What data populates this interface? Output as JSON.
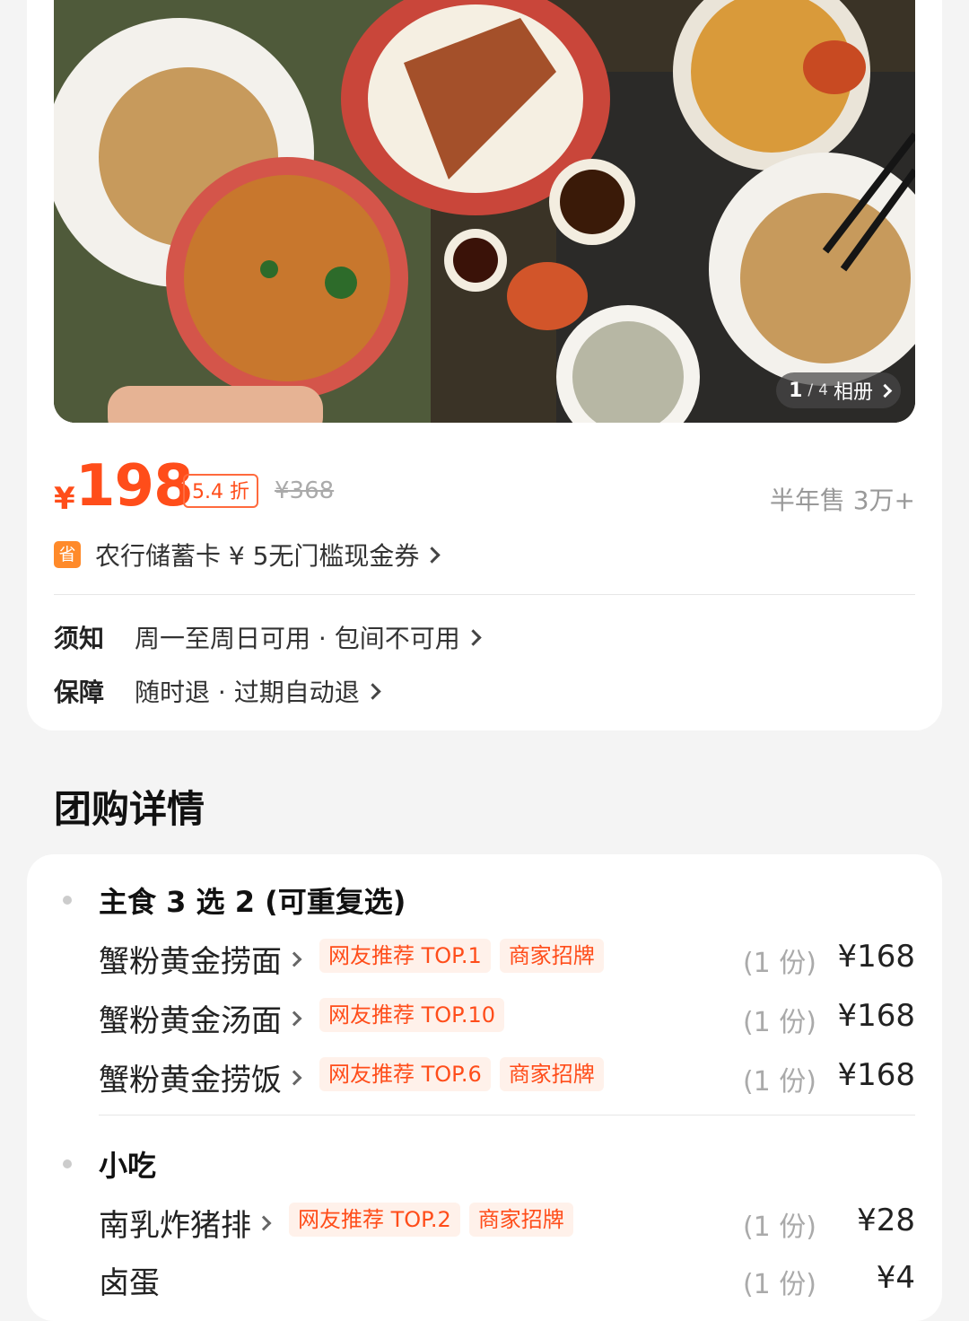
{
  "gallery": {
    "index": "1",
    "total": "4",
    "album_label": "相册"
  },
  "price": {
    "currency": "¥",
    "amount": "198",
    "discount": "5.4 折",
    "original": "¥368",
    "sales": "半年售 3万+"
  },
  "coupon": {
    "icon_text": "省",
    "text": "农行储蓄卡 ¥ 5无门槛现金券"
  },
  "notice": {
    "label": "须知",
    "value": "周一至周日可用 · 包间不可用"
  },
  "guarantee": {
    "label": "保障",
    "value": "随时退 · 过期自动退"
  },
  "section_title": "团购详情",
  "groups": [
    {
      "title": "主食 3 选 2 (可重复选)",
      "items": [
        {
          "name": "蟹粉黄金捞面",
          "tags": [
            "网友推荐 TOP.1",
            "商家招牌"
          ],
          "qty": "(1 份)",
          "price": "¥168"
        },
        {
          "name": "蟹粉黄金汤面",
          "tags": [
            "网友推荐 TOP.10"
          ],
          "qty": "(1 份)",
          "price": "¥168"
        },
        {
          "name": "蟹粉黄金捞饭",
          "tags": [
            "网友推荐 TOP.6",
            "商家招牌"
          ],
          "qty": "(1 份)",
          "price": "¥168"
        }
      ]
    },
    {
      "title": "小吃",
      "items": [
        {
          "name": "南乳炸猪排",
          "tags": [
            "网友推荐 TOP.2",
            "商家招牌"
          ],
          "qty": "(1 份)",
          "price": "¥28"
        },
        {
          "name": "卤蛋",
          "tags": [],
          "qty": "(1 份)",
          "price": "¥4"
        }
      ]
    }
  ],
  "colors": {
    "accent": "#ff4d1a",
    "tag_bg": "#fff1ea",
    "page_bg": "#f4f4f4"
  }
}
